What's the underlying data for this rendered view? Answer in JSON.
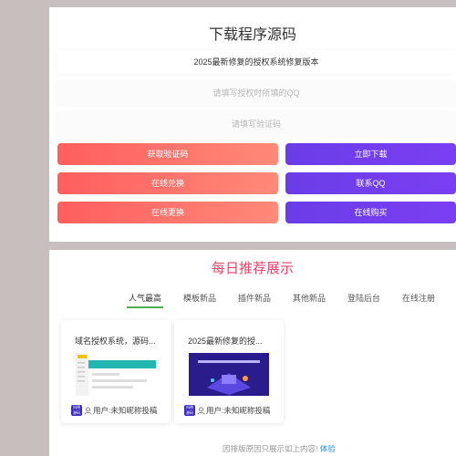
{
  "download": {
    "title": "下载程序源码",
    "version_value": "2025最新修复的授权系统修复版本",
    "qq_placeholder": "请填写授权时所填的QQ",
    "code_placeholder": "请填写验证码",
    "buttons": {
      "get_code": "获取验证码",
      "download_now": "立即下载",
      "redeem_online": "在线兑换",
      "contact_qq": "联系QQ",
      "update_online": "在线更换",
      "buy_online": "在线购买"
    }
  },
  "recommend": {
    "title": "每日推荐展示",
    "tabs": [
      "人气最高",
      "模板新品",
      "插件新品",
      "其他新品",
      "登陆后台",
      "在线注册"
    ],
    "active_tab": 0,
    "products": [
      {
        "title": "域名授权系统，源码...",
        "author": "用户:未知昵称投稿",
        "badge": "科德\n源码"
      },
      {
        "title": "2025最新修复的授...",
        "author": "用户:未知昵称投稿",
        "badge": "科德\n源码"
      }
    ],
    "footer_text": "因排版原因只展示如上内容!",
    "footer_link": "体验"
  },
  "colors": {
    "red": "#ff5e5e",
    "purple": "#6a3de8",
    "pink_title": "#e8456b",
    "tab_underline": "#4caf50"
  }
}
